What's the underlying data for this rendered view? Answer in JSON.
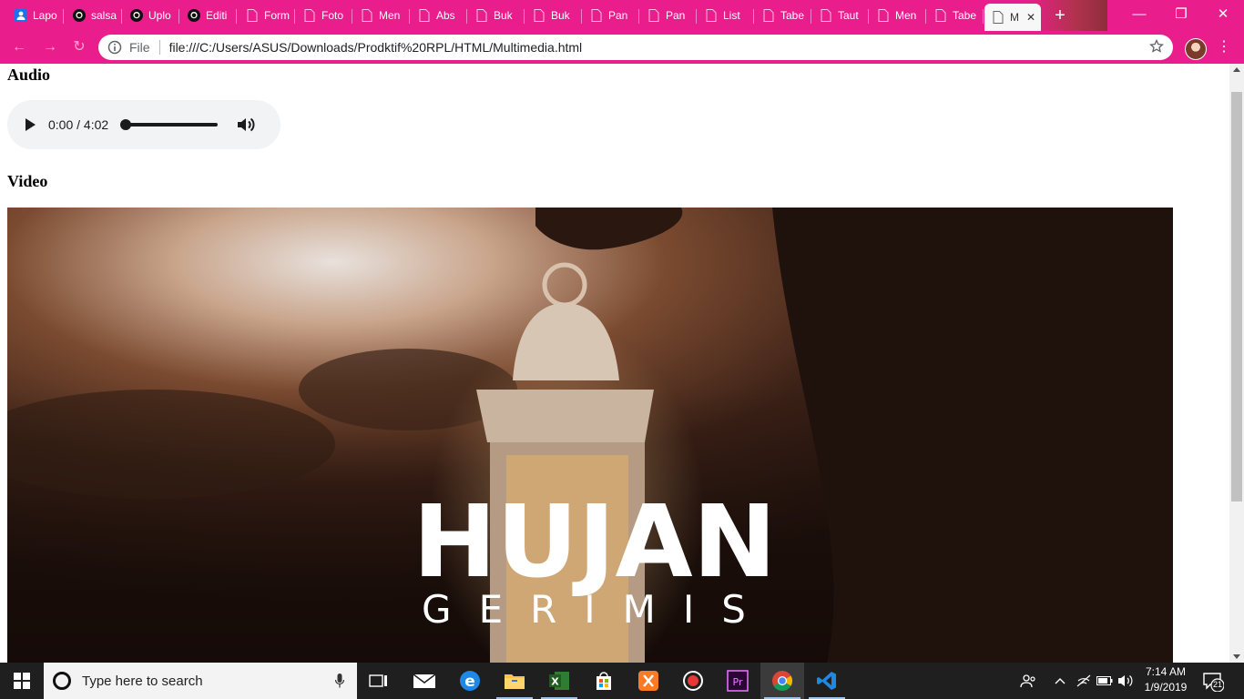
{
  "browser": {
    "tabs": [
      {
        "label": "Lapo",
        "icon": "person-icon"
      },
      {
        "label": "salsa",
        "icon": "github-icon"
      },
      {
        "label": "Uplo",
        "icon": "github-icon"
      },
      {
        "label": "Editi",
        "icon": "github-icon"
      },
      {
        "label": "Form",
        "icon": "file-icon"
      },
      {
        "label": "Foto",
        "icon": "file-icon"
      },
      {
        "label": "Men",
        "icon": "file-icon"
      },
      {
        "label": "Abs",
        "icon": "file-icon"
      },
      {
        "label": "Buk",
        "icon": "file-icon"
      },
      {
        "label": "Buk",
        "icon": "file-icon"
      },
      {
        "label": "Pan",
        "icon": "file-icon"
      },
      {
        "label": "Pan",
        "icon": "file-icon"
      },
      {
        "label": "List",
        "icon": "file-icon"
      },
      {
        "label": "Tabe",
        "icon": "file-icon"
      },
      {
        "label": "Taut",
        "icon": "file-icon"
      },
      {
        "label": "Men",
        "icon": "file-icon"
      },
      {
        "label": "Tabe",
        "icon": "file-icon"
      },
      {
        "label": "M",
        "icon": "file-icon",
        "active": true
      }
    ],
    "new_tab_label": "+",
    "address": {
      "scheme_label": "File",
      "url": "file:///C:/Users/ASUS/Downloads/Prodktif%20RPL/HTML/Multimedia.html"
    },
    "theme_color": "#e91e8c"
  },
  "page": {
    "audio_heading": "Audio",
    "audio_time": "0:00 / 4:02",
    "audio_progress": 0,
    "video_heading": "Video",
    "video_title": "HUJAN",
    "video_subtitle": "GERIMIS"
  },
  "taskbar": {
    "search_placeholder": "Type here to search",
    "apps": [
      "task-view",
      "mail",
      "edge",
      "file-explorer",
      "excel",
      "store",
      "xampp",
      "recorder",
      "premiere",
      "chrome",
      "vscode"
    ],
    "clock_time": "7:14 AM",
    "clock_date": "1/9/2019",
    "notification_count": "21"
  }
}
